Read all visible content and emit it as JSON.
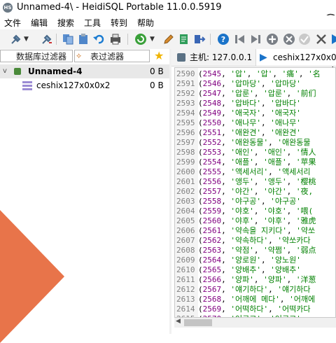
{
  "window": {
    "title": "Unnamed-4\\ - HeidiSQL Portable 11.0.0.5919",
    "app_icon_text": "HS"
  },
  "menu": [
    "文件",
    "编辑",
    "搜索",
    "工具",
    "转到",
    "帮助"
  ],
  "filters": {
    "db_filter": "数据库过滤器",
    "table_filter": "表过滤器"
  },
  "tree": {
    "root": {
      "label": "Unnamed-4",
      "size": "0 B"
    },
    "child": {
      "label": "ceshix127x0x0x2",
      "size": "0 B"
    }
  },
  "tabs": {
    "host": "主机: 127.0.0.1",
    "query": "ceshix127x0x0x"
  },
  "colors": {
    "accent": "#1a73c9",
    "orange": "#e8744a",
    "number": "#800080",
    "string": "#008000"
  },
  "code_lines": [
    {
      "n": "2590",
      "id": "2545",
      "a": "'압'",
      "b": "'압'",
      "c": "'痛'",
      "d": "'名"
    },
    {
      "n": "2591",
      "id": "2546",
      "a": "'압마당'",
      "b": "'압마당'",
      "c": "",
      "d": ""
    },
    {
      "n": "2592",
      "id": "2547",
      "a": "'압룬'",
      "b": "'압룬'",
      "c": "'前们",
      "d": ""
    },
    {
      "n": "2593",
      "id": "2548",
      "a": "'압바다'",
      "b": "'압바다'",
      "c": "",
      "d": ""
    },
    {
      "n": "2594",
      "id": "2549",
      "a": "'애국자'",
      "b": "'애국자'",
      "c": "",
      "d": ""
    },
    {
      "n": "2595",
      "id": "2550",
      "a": "'애나무'",
      "b": "'애나무'",
      "c": "",
      "d": ""
    },
    {
      "n": "2596",
      "id": "2551",
      "a": "'애완견'",
      "b": "'애완견'",
      "c": "",
      "d": ""
    },
    {
      "n": "2597",
      "id": "2552",
      "a": "'애완동물'",
      "b": "'애완동물",
      "c": "",
      "d": ""
    },
    {
      "n": "2598",
      "id": "2553",
      "a": "'애인'",
      "b": "'애인'",
      "c": "'情人",
      "d": ""
    },
    {
      "n": "2599",
      "id": "2554",
      "a": "'애플'",
      "b": "'애플'",
      "c": "'苹果",
      "d": ""
    },
    {
      "n": "2600",
      "id": "2555",
      "a": "'액세서리'",
      "b": "'액세서리",
      "c": "",
      "d": ""
    },
    {
      "n": "2601",
      "id": "2556",
      "a": "'앵두'",
      "b": "'앵두'",
      "c": "'樱桃",
      "d": ""
    },
    {
      "n": "2602",
      "id": "2557",
      "a": "'야간'",
      "b": "'야간'",
      "c": "'夜,",
      "d": ""
    },
    {
      "n": "2603",
      "id": "2558",
      "a": "'야구공'",
      "b": "'야구공'",
      "c": "",
      "d": ""
    },
    {
      "n": "2604",
      "id": "2559",
      "a": "'야호'",
      "b": "'야호'",
      "c": "'喂(",
      "d": ""
    },
    {
      "n": "2605",
      "id": "2560",
      "a": "'야후'",
      "b": "'야후'",
      "c": "'雅虎",
      "d": ""
    },
    {
      "n": "2606",
      "id": "2561",
      "a": "'약속을 지키다'",
      "b": "'약쏘",
      "c": "",
      "d": ""
    },
    {
      "n": "2607",
      "id": "2562",
      "a": "'약속하다'",
      "b": "'약쏘카다",
      "c": "",
      "d": ""
    },
    {
      "n": "2608",
      "id": "2563",
      "a": "'약점'",
      "b": "'약쩜'",
      "c": "'弱点",
      "d": ""
    },
    {
      "n": "2609",
      "id": "2564",
      "a": "'양로원'",
      "b": "'양노원'",
      "c": "",
      "d": ""
    },
    {
      "n": "2610",
      "id": "2565",
      "a": "'양배추'",
      "b": "'양배추'",
      "c": "",
      "d": ""
    },
    {
      "n": "2611",
      "id": "2566",
      "a": "'양파'",
      "b": "'양파'",
      "c": "'洋葱",
      "d": ""
    },
    {
      "n": "2612",
      "id": "2567",
      "a": "'얘기하다'",
      "b": "'얘기하다",
      "c": "",
      "d": ""
    },
    {
      "n": "2613",
      "id": "2568",
      "a": "'어깨에 메다'",
      "b": "'어깨에",
      "c": "",
      "d": ""
    },
    {
      "n": "2614",
      "id": "2569",
      "a": "'어떡하다'",
      "b": "'어떡카다",
      "c": "",
      "d": ""
    },
    {
      "n": "2615",
      "id": "2570",
      "a": "'어르고'",
      "b": "'어르고'",
      "c": "",
      "d": ""
    }
  ]
}
